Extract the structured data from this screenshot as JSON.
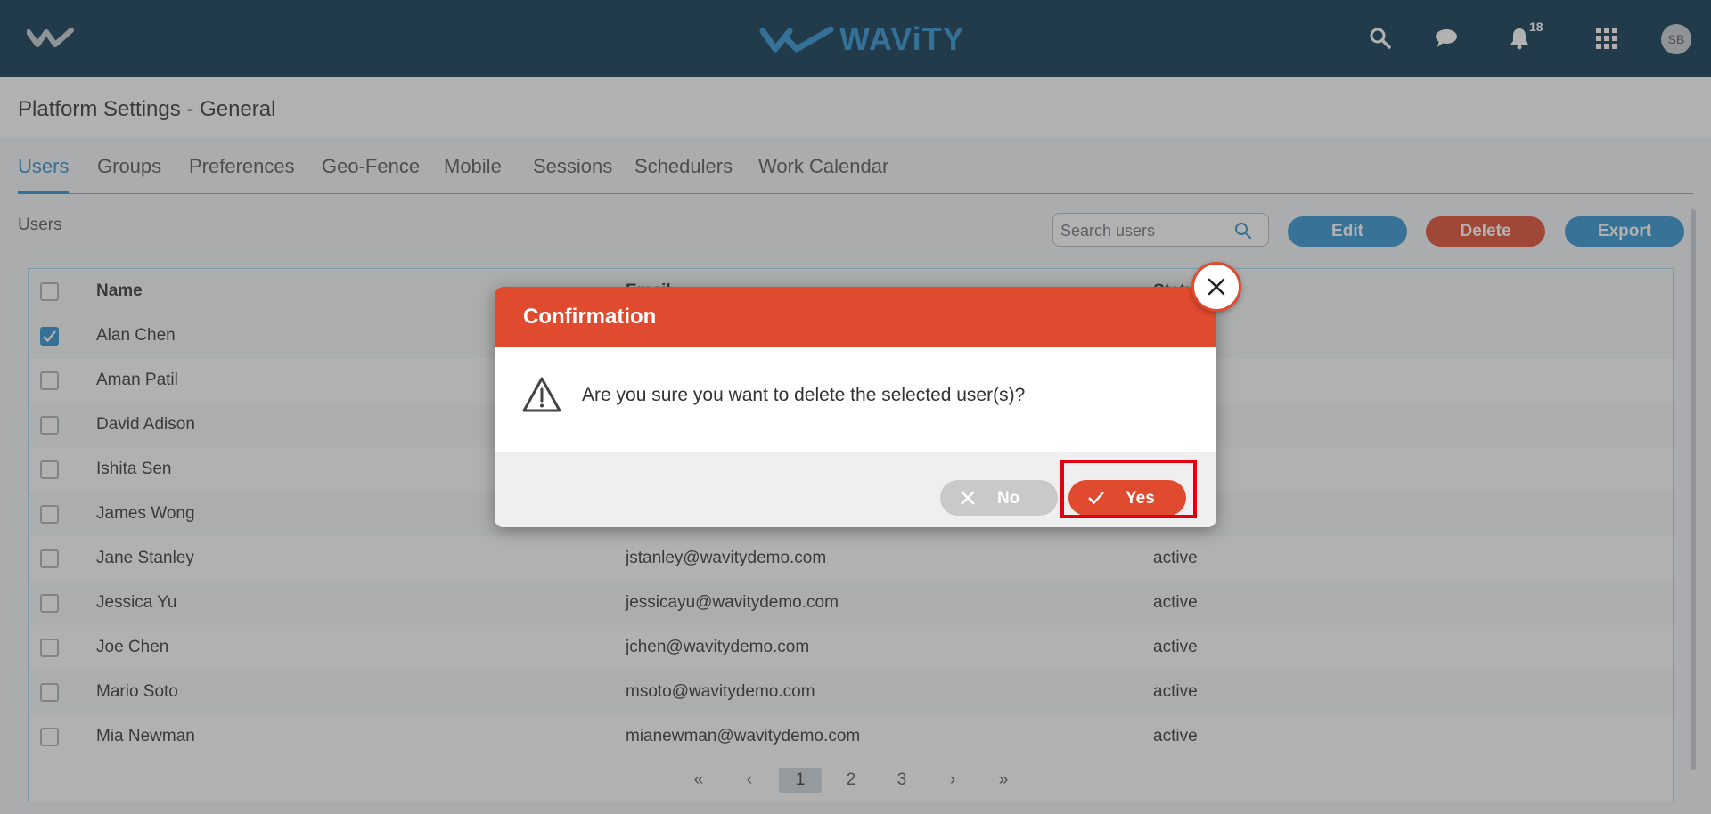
{
  "app": {
    "brand": "WAViTY",
    "notification_count": "18",
    "avatar_initials": "SB"
  },
  "page": {
    "title": "Platform Settings - General"
  },
  "tabs": [
    {
      "label": "Users",
      "active": true
    },
    {
      "label": "Groups"
    },
    {
      "label": "Preferences"
    },
    {
      "label": "Geo-Fence"
    },
    {
      "label": "Mobile"
    },
    {
      "label": "Sessions"
    },
    {
      "label": "Schedulers"
    },
    {
      "label": "Work Calendar"
    }
  ],
  "toolbar": {
    "section_label": "Users",
    "search_placeholder": "Search users",
    "edit_label": "Edit",
    "delete_label": "Delete",
    "export_label": "Export"
  },
  "table": {
    "headers": {
      "name": "Name",
      "email": "Email",
      "status": "Status"
    },
    "rows": [
      {
        "name": "Alan Chen",
        "email": "",
        "status": "",
        "checked": true
      },
      {
        "name": "Aman Patil",
        "email": "",
        "status": ""
      },
      {
        "name": "David Adison",
        "email": "",
        "status": ""
      },
      {
        "name": "Ishita Sen",
        "email": "",
        "status": ""
      },
      {
        "name": "James Wong",
        "email": "",
        "status": ""
      },
      {
        "name": "Jane Stanley",
        "email": "jstanley@wavitydemo.com",
        "status": "active"
      },
      {
        "name": "Jessica Yu",
        "email": "jessicayu@wavitydemo.com",
        "status": "active"
      },
      {
        "name": "Joe Chen",
        "email": "jchen@wavitydemo.com",
        "status": "active"
      },
      {
        "name": "Mario Soto",
        "email": "msoto@wavitydemo.com",
        "status": "active"
      },
      {
        "name": "Mia Newman",
        "email": "mianewman@wavitydemo.com",
        "status": "active"
      }
    ]
  },
  "pagination": {
    "first": "«",
    "prev": "‹",
    "pages": [
      "1",
      "2",
      "3"
    ],
    "current": "1",
    "next": "›",
    "last": "»"
  },
  "modal": {
    "title": "Confirmation",
    "message": "Are you sure you want to delete the selected user(s)?",
    "no_label": "No",
    "yes_label": "Yes"
  },
  "colors": {
    "topbar": "#0a3550",
    "accent": "#2a8fd0",
    "danger": "#e04a2f"
  }
}
